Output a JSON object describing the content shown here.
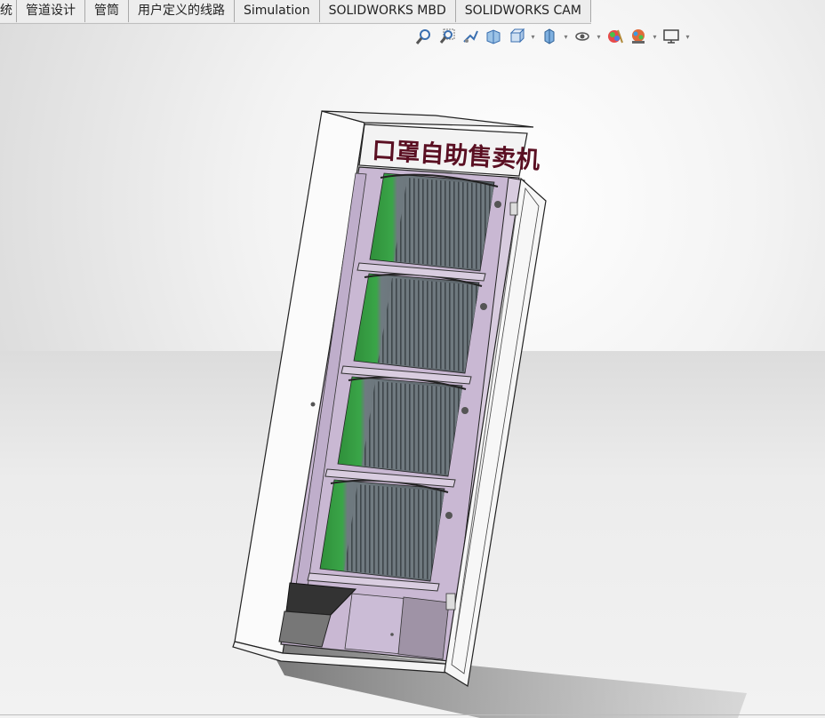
{
  "tabs": [
    {
      "label": "统"
    },
    {
      "label": "管道设计"
    },
    {
      "label": "管筒"
    },
    {
      "label": "用户定义的线路"
    },
    {
      "label": "Simulation"
    },
    {
      "label": "SOLIDWORKS MBD"
    },
    {
      "label": "SOLIDWORKS CAM"
    }
  ],
  "model": {
    "sign_text": "口罩自助售卖机"
  },
  "heads_up_icons": [
    "zoom-to-fit-icon",
    "zoom-to-area-icon",
    "previous-view-icon",
    "section-view-icon",
    "view-orientation-icon",
    "display-style-icon",
    "hide-show-items-icon",
    "edit-appearance-icon",
    "apply-scene-icon",
    "view-settings-icon"
  ],
  "colors": {
    "cabinet_interior": "#c9b8d3",
    "cabinet_shell": "#fafafa",
    "sign_text": "#5a0f22",
    "coil_green": "#3b8f3b"
  }
}
